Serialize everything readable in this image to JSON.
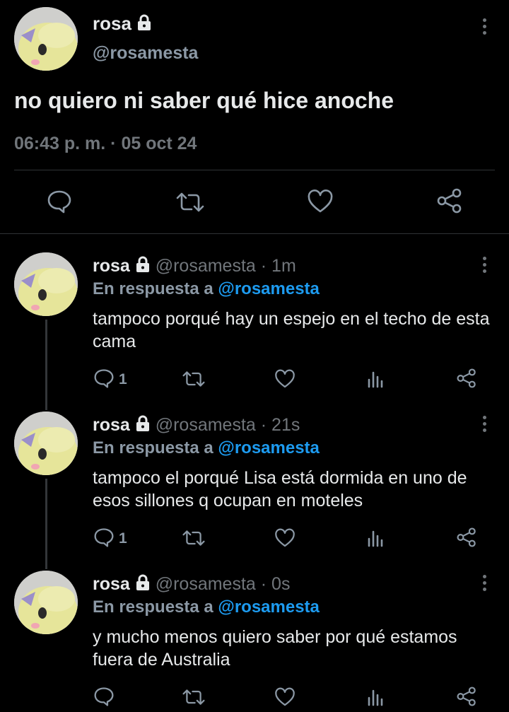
{
  "main_tweet": {
    "name": "rosa",
    "handle": "@rosamesta",
    "text": "no quiero ni saber qué hice anoche",
    "timestamp": "06:43 p. m. · 05 oct 24"
  },
  "replies": [
    {
      "name": "rosa",
      "handle": "@rosamesta",
      "time": "· 1m",
      "reply_label": "En respuesta a",
      "reply_to": "@rosamesta",
      "text": "tampoco porqué hay un espejo en el techo de esta cama",
      "reply_count": "1"
    },
    {
      "name": "rosa",
      "handle": "@rosamesta",
      "time": "· 21s",
      "reply_label": "En respuesta a",
      "reply_to": "@rosamesta",
      "text": "tampoco el porqué Lisa está dormida en uno de esos sillones q ocupan en moteles",
      "reply_count": "1"
    },
    {
      "name": "rosa",
      "handle": "@rosamesta",
      "time": "· 0s",
      "reply_label": "En respuesta a",
      "reply_to": "@rosamesta",
      "text": "y mucho menos quiero saber por qué estamos fuera de Australia",
      "reply_count": ""
    }
  ],
  "icons": {
    "lock": "lock-icon",
    "more": "more-icon",
    "reply": "reply-icon",
    "retweet": "retweet-icon",
    "like": "heart-icon",
    "views": "views-icon",
    "share": "share-icon"
  },
  "colors": {
    "background": "#000000",
    "text": "#e7e9ea",
    "secondary": "#71767b",
    "link": "#1d9bf0"
  }
}
